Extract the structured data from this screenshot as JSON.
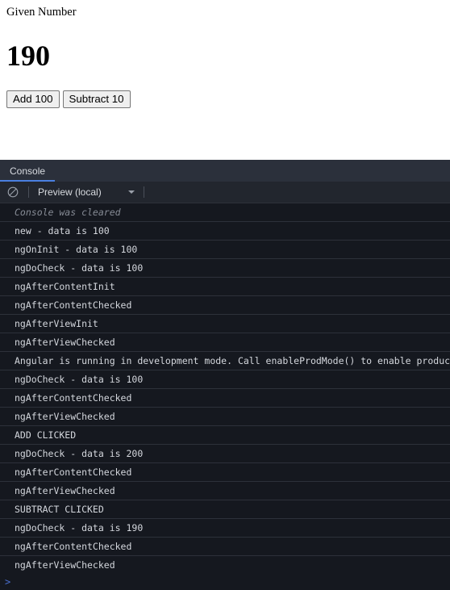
{
  "app": {
    "label": "Given Number",
    "value": "190",
    "buttons": [
      {
        "label": "Add 100",
        "name": "add-100-button"
      },
      {
        "label": "Subtract 10",
        "name": "subtract-10-button"
      }
    ]
  },
  "devtools": {
    "tabs": [
      {
        "label": "Console",
        "active": true
      }
    ],
    "toolbar": {
      "clear_icon": "clear-console-icon",
      "context_label": "Preview (local)",
      "caret_icon": "chevron-down-icon"
    },
    "prompt": {
      "chevron": ">",
      "value": ""
    },
    "logs": [
      {
        "text": "Console was cleared",
        "style": "cleared"
      },
      {
        "text": "new - data is 100",
        "style": "normal"
      },
      {
        "text": "ngOnInit - data is 100",
        "style": "normal"
      },
      {
        "text": "ngDoCheck - data is 100",
        "style": "normal"
      },
      {
        "text": "ngAfterContentInit",
        "style": "normal"
      },
      {
        "text": "ngAfterContentChecked",
        "style": "normal"
      },
      {
        "text": "ngAfterViewInit",
        "style": "normal"
      },
      {
        "text": "ngAfterViewChecked",
        "style": "normal"
      },
      {
        "text": "Angular is running in development mode. Call enableProdMode() to enable production mode.",
        "style": "normal"
      },
      {
        "text": "ngDoCheck - data is 100",
        "style": "normal"
      },
      {
        "text": "ngAfterContentChecked",
        "style": "normal"
      },
      {
        "text": "ngAfterViewChecked",
        "style": "normal"
      },
      {
        "text": "ADD CLICKED",
        "style": "normal"
      },
      {
        "text": "ngDoCheck - data is 200",
        "style": "normal"
      },
      {
        "text": "ngAfterContentChecked",
        "style": "normal"
      },
      {
        "text": "ngAfterViewChecked",
        "style": "normal"
      },
      {
        "text": "SUBTRACT CLICKED",
        "style": "normal"
      },
      {
        "text": "ngDoCheck - data is 190",
        "style": "normal"
      },
      {
        "text": "ngAfterContentChecked",
        "style": "normal"
      },
      {
        "text": "ngAfterViewChecked",
        "style": "normal"
      }
    ]
  },
  "colors": {
    "accent": "#4a7fe0",
    "prompt": "#4a6fd0",
    "panel_bg": "#15181f",
    "tabbar_bg": "#2b303b",
    "toolbar_bg": "#22262e"
  }
}
